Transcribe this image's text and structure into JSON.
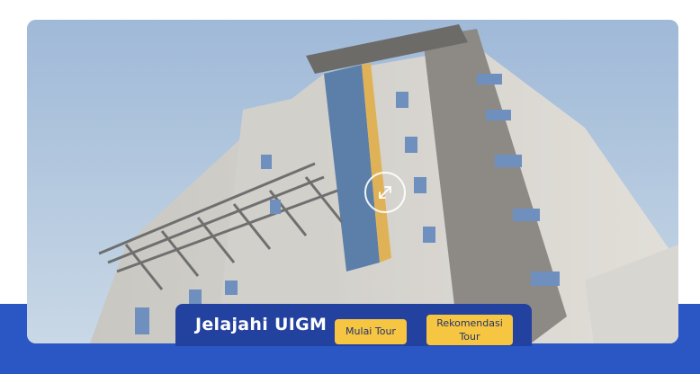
{
  "hero": {
    "expand_icon": "expand-arrows-icon"
  },
  "cta": {
    "title": "Jelajahi UIGM",
    "start_tour_label": "Mulai Tour",
    "recommend_tour_label": "Rekomendasi Tour"
  },
  "colors": {
    "band": "#2a57c4",
    "cta_bar": "#23419e",
    "button": "#f6c542"
  }
}
